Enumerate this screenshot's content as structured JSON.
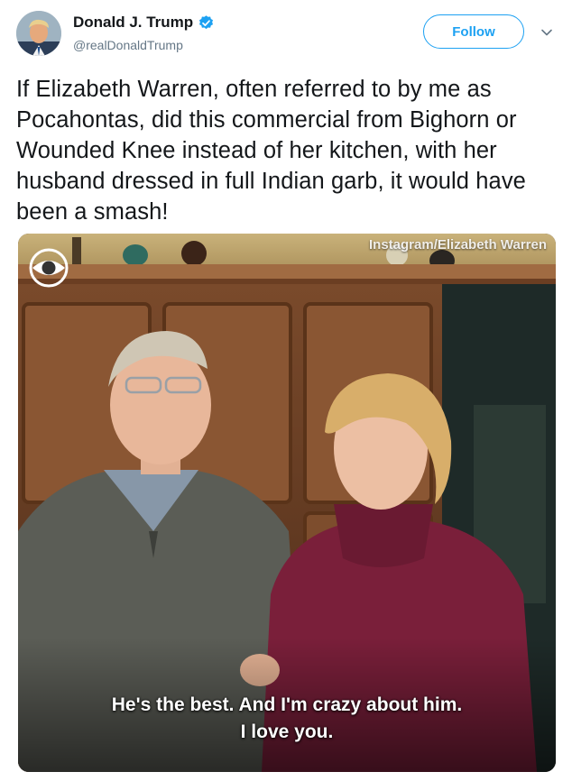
{
  "author": {
    "display_name": "Donald J. Trump",
    "handle": "@realDonaldTrump",
    "verified": true
  },
  "actions": {
    "follow_label": "Follow"
  },
  "tweet": {
    "text": "If Elizabeth Warren, often referred to by me as Pocahontas, did this commercial from Bighorn or Wounded Knee instead of her kitchen, with her husband dressed in full Indian garb, it would have been a smash!"
  },
  "media": {
    "watermark": "Instagram/Elizabeth Warren",
    "caption_line1": "He's the best. And I'm crazy about him.",
    "caption_line2": "I love you."
  },
  "colors": {
    "accent": "#1da1f2",
    "text": "#14171a",
    "secondary": "#657786"
  }
}
